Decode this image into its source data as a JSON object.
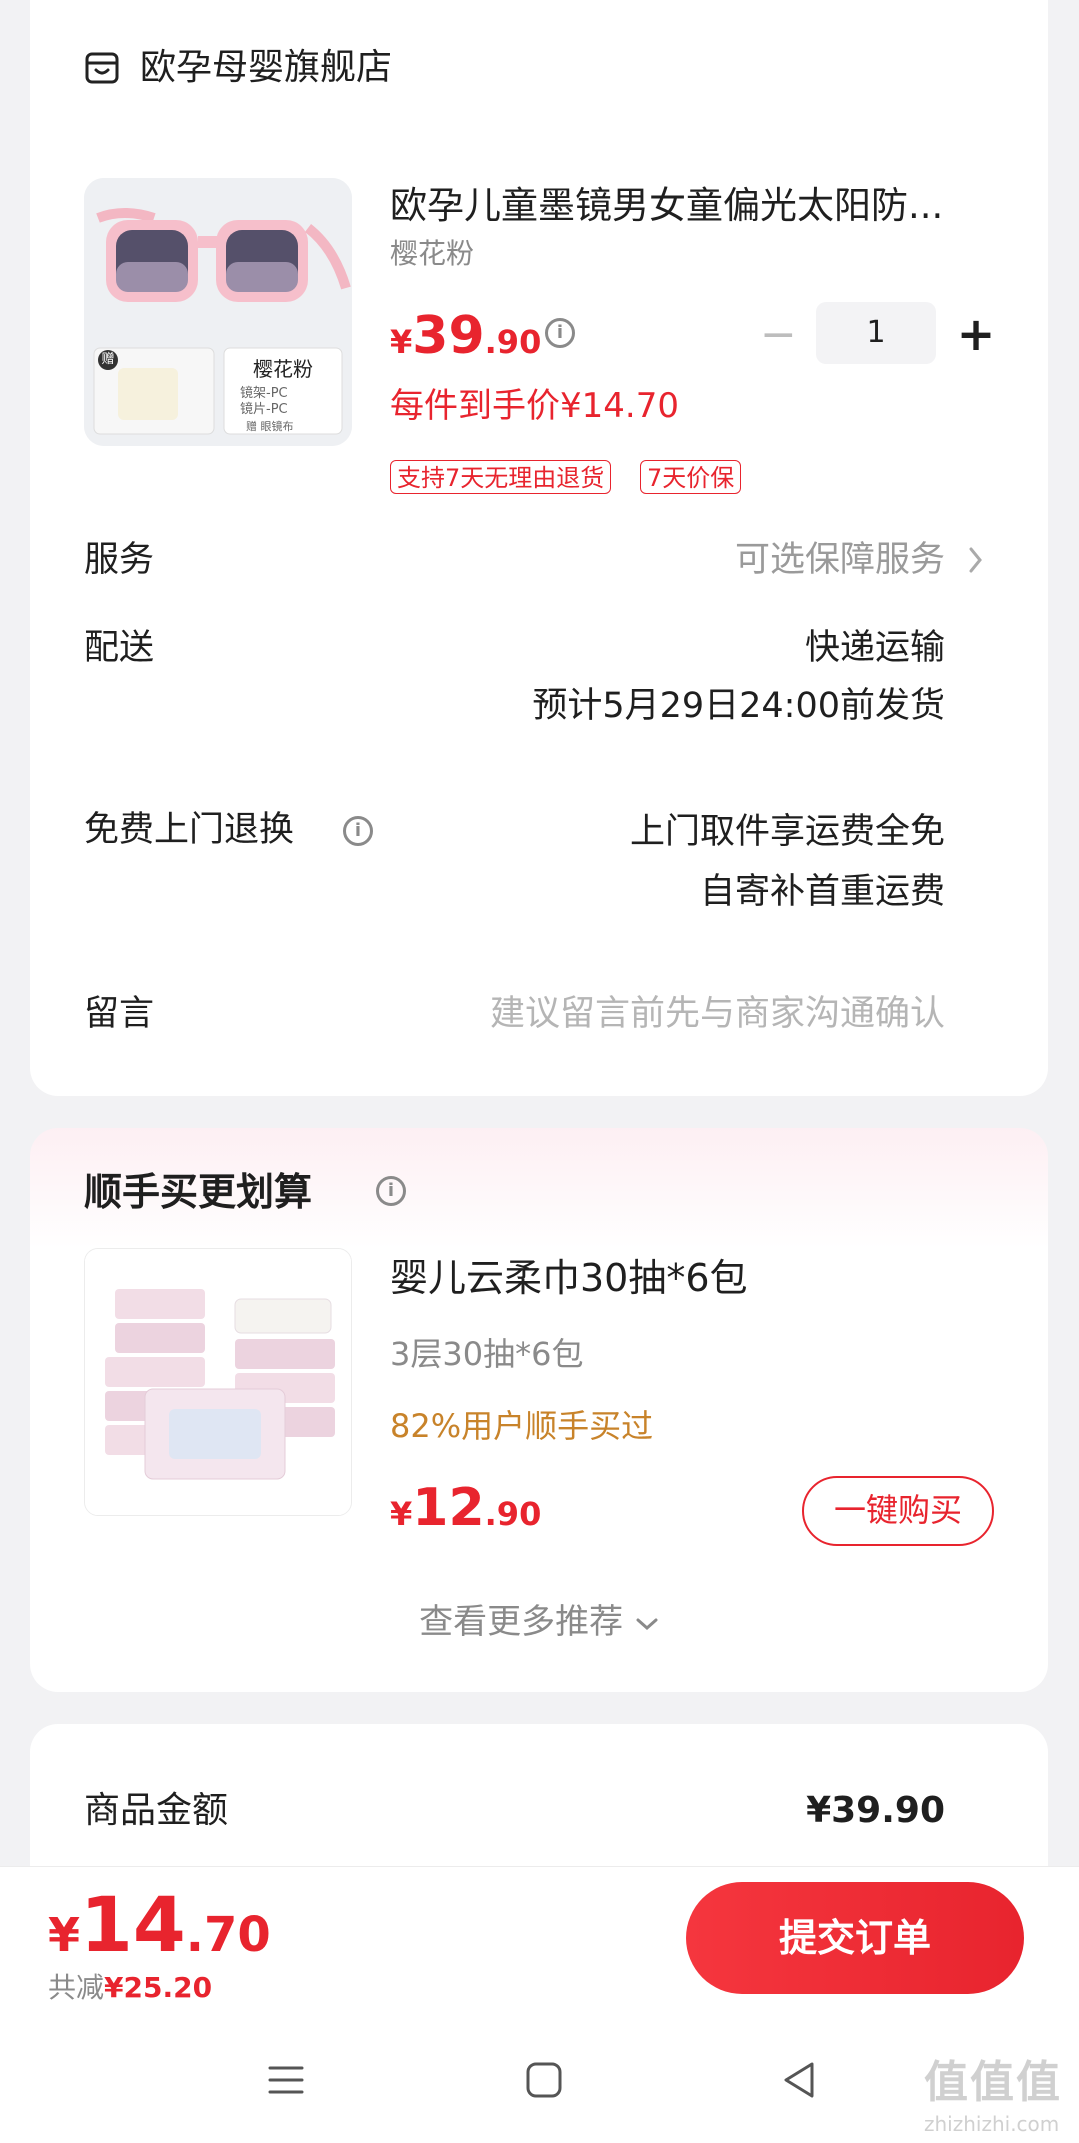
{
  "store": {
    "icon": "store-icon",
    "name": "欧孕母婴旗舰店"
  },
  "product": {
    "name": "欧孕儿童墨镜男女童偏光太阳防...",
    "spec": "樱花粉",
    "price_currency": "¥",
    "price_int": "39",
    "price_dec": ".90",
    "quantity": "1",
    "per_piece": "每件到手价¥14.70",
    "tags": [
      "支持7天无理由退货",
      "7天价保"
    ],
    "thumb": {
      "gift_badge": "赠",
      "label": "樱花粉",
      "line1": "镜架-PC",
      "line2": "镜片-PC",
      "line3": "赠 眼镜布"
    }
  },
  "rows": {
    "service_label": "服务",
    "service_value": "可选保障服务",
    "delivery_label": "配送",
    "delivery_value1": "快递运输",
    "delivery_value2": "预计5月29日24:00前发货",
    "return_label": "免费上门退换",
    "return_value1": "上门取件享运费全免",
    "return_value2": "自寄补首重运费",
    "message_label": "留言",
    "message_placeholder": "建议留言前先与商家沟通确认"
  },
  "recommend": {
    "title": "顺手买更划算",
    "item_name": "婴儿云柔巾30抽*6包",
    "item_spec": "3层30抽*6包",
    "buyers": "82%用户顺手买过",
    "price_currency": "¥",
    "price_int": "12",
    "price_dec": ".90",
    "buy_label": "一键购买",
    "more_label": "查看更多推荐"
  },
  "summary": {
    "goods_label": "商品金额",
    "goods_value": "¥39.90"
  },
  "bottom": {
    "total_currency": "¥",
    "total_int": "14",
    "total_dec": ".70",
    "saved_label": "共减",
    "saved_value": "¥25.20",
    "submit_label": "提交订单"
  },
  "watermark": {
    "logo": "值值值",
    "site": "zhizhizhi.com"
  },
  "colors": {
    "accent": "#e8242e",
    "buyers": "#c8832a",
    "background": "#f2f2f4"
  }
}
